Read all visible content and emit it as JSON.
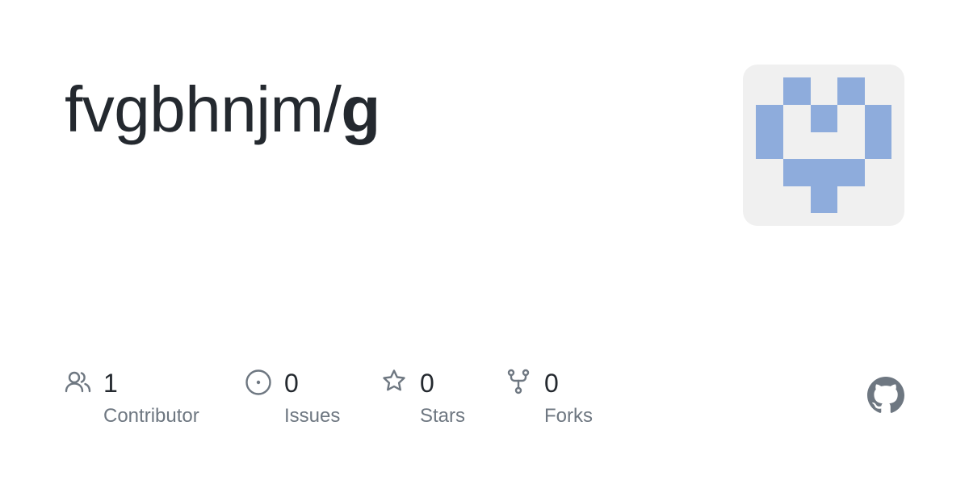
{
  "repo": {
    "owner": "fvgbhnjm/",
    "name": "g"
  },
  "avatar": {
    "icon": "identicon",
    "color": "#8eacdc",
    "background": "#f0f0f0"
  },
  "stats": {
    "contributors": {
      "count": "1",
      "label": "Contributor",
      "icon": "people-icon"
    },
    "issues": {
      "count": "0",
      "label": "Issues",
      "icon": "issue-icon"
    },
    "stars": {
      "count": "0",
      "label": "Stars",
      "icon": "star-icon"
    },
    "forks": {
      "count": "0",
      "label": "Forks",
      "icon": "fork-icon"
    }
  },
  "brand": {
    "icon": "github-mark-icon",
    "color": "#6e7781"
  }
}
